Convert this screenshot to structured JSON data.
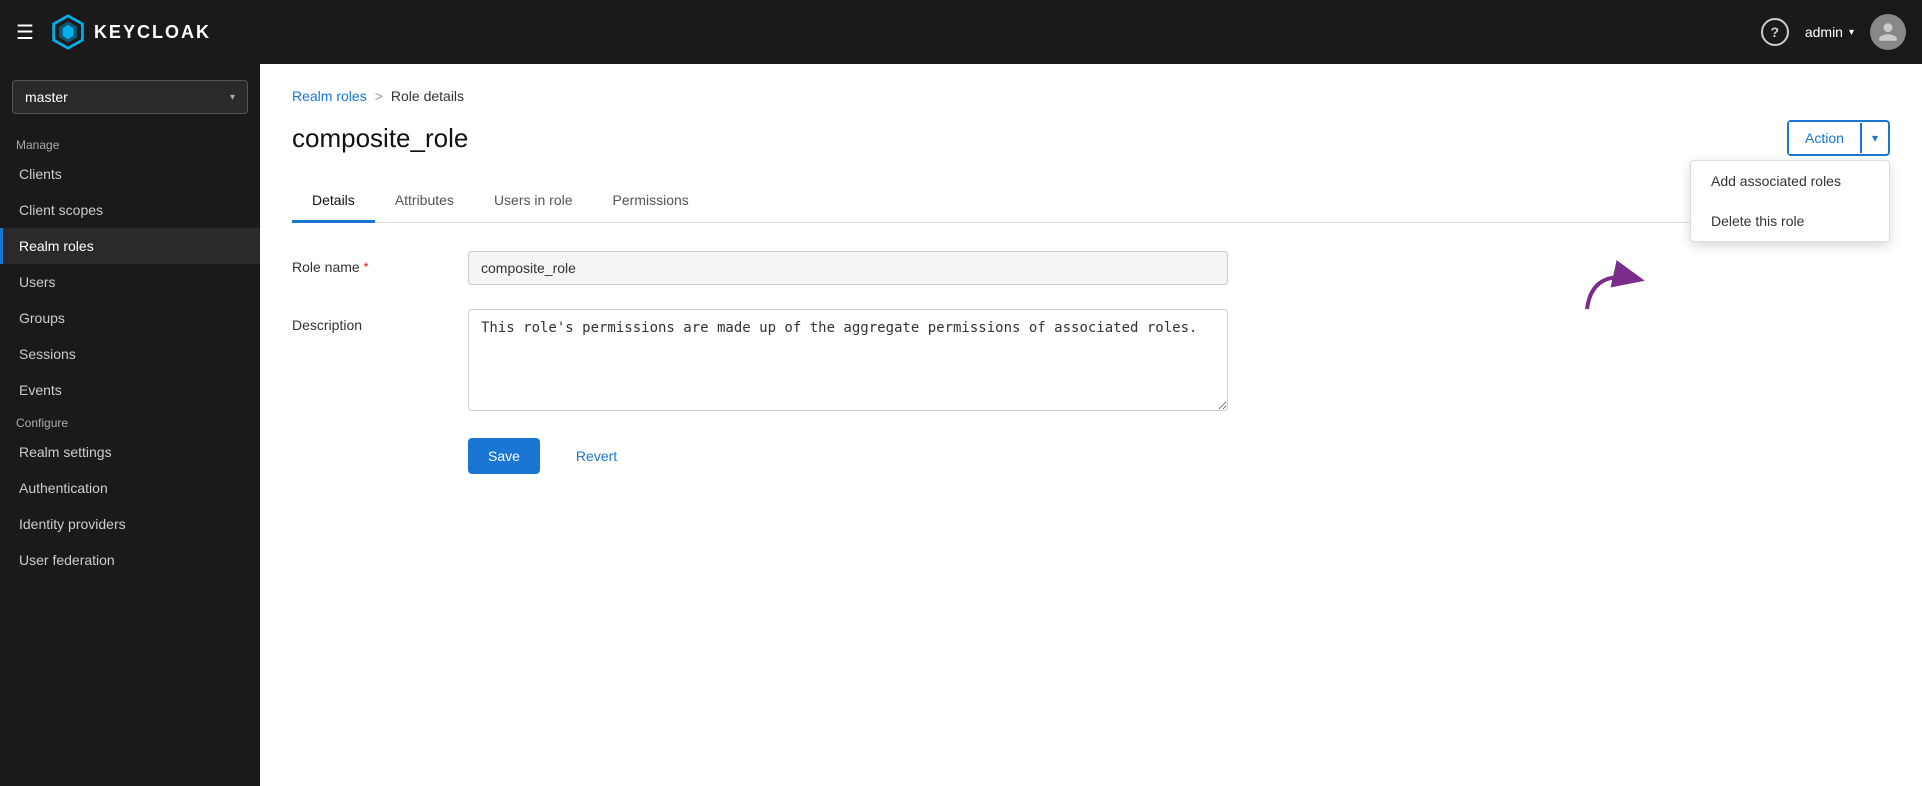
{
  "navbar": {
    "brand_text": "KEYCLOAK",
    "user_name": "admin",
    "help_label": "?",
    "hamburger": "☰"
  },
  "sidebar": {
    "realm": {
      "name": "master",
      "chevron": "▾"
    },
    "manage_section": "Manage",
    "items_manage": [
      {
        "id": "clients",
        "label": "Clients"
      },
      {
        "id": "client-scopes",
        "label": "Client scopes"
      },
      {
        "id": "realm-roles",
        "label": "Realm roles"
      },
      {
        "id": "users",
        "label": "Users"
      },
      {
        "id": "groups",
        "label": "Groups"
      },
      {
        "id": "sessions",
        "label": "Sessions"
      },
      {
        "id": "events",
        "label": "Events"
      }
    ],
    "configure_section": "Configure",
    "items_configure": [
      {
        "id": "realm-settings",
        "label": "Realm settings"
      },
      {
        "id": "authentication",
        "label": "Authentication"
      },
      {
        "id": "identity-providers",
        "label": "Identity providers"
      },
      {
        "id": "user-federation",
        "label": "User federation"
      }
    ]
  },
  "breadcrumb": {
    "parent_label": "Realm roles",
    "separator": ">",
    "current_label": "Role details"
  },
  "page": {
    "title": "composite_role",
    "action_label": "Action",
    "action_chevron": "▾"
  },
  "dropdown": {
    "items": [
      {
        "id": "add-associated-roles",
        "label": "Add associated roles"
      },
      {
        "id": "delete-role",
        "label": "Delete this role"
      }
    ]
  },
  "tabs": [
    {
      "id": "details",
      "label": "Details",
      "active": true
    },
    {
      "id": "attributes",
      "label": "Attributes",
      "active": false
    },
    {
      "id": "users-in-role",
      "label": "Users in role",
      "active": false
    },
    {
      "id": "permissions",
      "label": "Permissions",
      "active": false
    }
  ],
  "form": {
    "role_name_label": "Role name",
    "role_name_required": "*",
    "role_name_value": "composite_role",
    "description_label": "Description",
    "description_value": "This role's permissions are made up of the aggregate permissions of associated roles."
  },
  "buttons": {
    "save_label": "Save",
    "revert_label": "Revert"
  }
}
